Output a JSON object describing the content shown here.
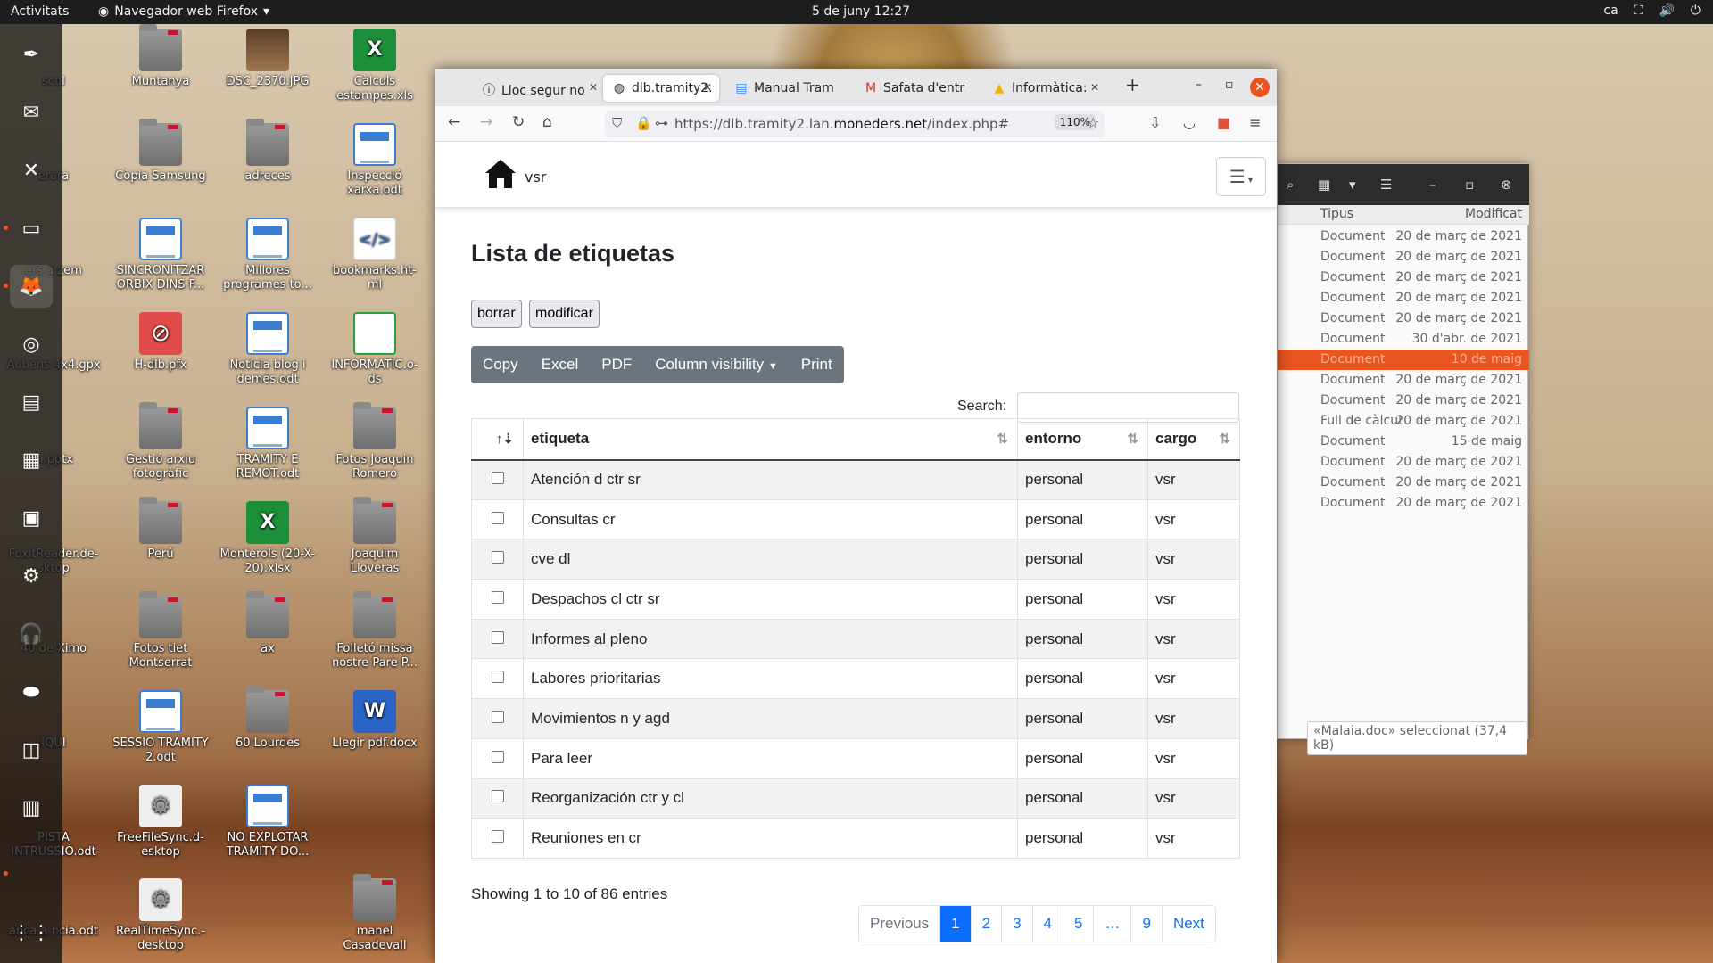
{
  "topbar": {
    "activities": "Activitats",
    "app": "Navegador web Firefox",
    "clock": "5 de juny  12:27",
    "lang": "ca"
  },
  "desktop": {
    "icons": [
      {
        "label": "Muntanya"
      },
      {
        "label": "DSC_2370.JPG"
      },
      {
        "label": "Càlculs estampes.xls"
      },
      {
        "label": "Còpia Samsung"
      },
      {
        "label": "adreces"
      },
      {
        "label": "Inspecció xarxa.odt"
      },
      {
        "label": "SINCRONITZAR ORBIX DINS F..."
      },
      {
        "label": "Millores programes to..."
      },
      {
        "label": "bookmarks.ht-ml"
      },
      {
        "label": "H-dlb.pfx"
      },
      {
        "label": "Notícia blog i demés.odt"
      },
      {
        "label": "INFORMATIC.o-ds"
      },
      {
        "label": "Gestió arxiu fotogràfic"
      },
      {
        "label": "TRAMITY E REMOT.odt"
      },
      {
        "label": "Fotos Joaquin Romero"
      },
      {
        "label": "Perú"
      },
      {
        "label": "Monterols (20-X-20).xlsx"
      },
      {
        "label": "Joaquim Lloveras"
      },
      {
        "label": "Fotos tiet Montserrat"
      },
      {
        "label": "ax"
      },
      {
        "label": "Folletó missa nostre Pare P..."
      },
      {
        "label": "SESSIO TRAMITY 2.odt"
      },
      {
        "label": "60 Lourdes"
      },
      {
        "label": "Llegir pdf.docx"
      },
      {
        "label": "FreeFileSync.d-esktop"
      },
      {
        "label": "NO EXPLOTAR TRAMITY DO..."
      },
      {
        "label": "RealTimeSync.-desktop"
      },
      {
        "label": "manel Casadevall"
      }
    ],
    "left_partial": [
      "scol",
      "erera",
      "ers a zem",
      "Aubens 4x4.gpx",
      "ci.pptx",
      "FoxitReader.de-sktop",
      "40 de Ximo",
      "IQUI",
      "PISTA INTRUSSIÓ.odt",
      "anca a ncia.odt"
    ]
  },
  "browser": {
    "tabs": [
      {
        "label": "Lloc segur no",
        "icon": "info-icon"
      },
      {
        "label": "dlb.tramity2.",
        "icon": "globe-icon"
      },
      {
        "label": "Manual Tram",
        "icon": "docs-icon"
      },
      {
        "label": "Safata d'entr",
        "icon": "gmail-icon"
      },
      {
        "label": "Informàtica:",
        "icon": "drive-icon"
      }
    ],
    "url_prefix": "https://dlb.tramity2.lan.",
    "url_domain": "moneders.net",
    "url_suffix": "/index.php#",
    "zoom": "110%"
  },
  "site": {
    "brand": "vsr"
  },
  "main": {
    "title": "Lista de etiquetas",
    "btn_delete": "borrar",
    "btn_modify": "modificar",
    "export_buttons": [
      "Copy",
      "Excel",
      "PDF",
      "Column visibility",
      "Print"
    ],
    "search_label": "Search:",
    "search_value": "",
    "columns": [
      "",
      "etiqueta",
      "entorno",
      "cargo"
    ],
    "rows": [
      {
        "etiqueta": "Atención d ctr sr",
        "entorno": "personal",
        "cargo": "vsr"
      },
      {
        "etiqueta": "Consultas cr",
        "entorno": "personal",
        "cargo": "vsr"
      },
      {
        "etiqueta": "cve dl",
        "entorno": "personal",
        "cargo": "vsr"
      },
      {
        "etiqueta": "Despachos cl ctr sr",
        "entorno": "personal",
        "cargo": "vsr"
      },
      {
        "etiqueta": "Informes al pleno",
        "entorno": "personal",
        "cargo": "vsr"
      },
      {
        "etiqueta": "Labores prioritarias",
        "entorno": "personal",
        "cargo": "vsr"
      },
      {
        "etiqueta": "Movimientos n y agd",
        "entorno": "personal",
        "cargo": "vsr"
      },
      {
        "etiqueta": "Para leer",
        "entorno": "personal",
        "cargo": "vsr"
      },
      {
        "etiqueta": "Reorganización ctr y cl",
        "entorno": "personal",
        "cargo": "vsr"
      },
      {
        "etiqueta": "Reuniones en cr",
        "entorno": "personal",
        "cargo": "vsr"
      }
    ],
    "info": "Showing 1 to 10 of 86 entries",
    "pagination": [
      "Previous",
      "1",
      "2",
      "3",
      "4",
      "5",
      "…",
      "9",
      "Next"
    ],
    "active_page": "1"
  },
  "files": {
    "col_type": "Tipus",
    "col_modified": "Modificat",
    "rows": [
      {
        "type": "Document",
        "modified": "20 de març de 2021"
      },
      {
        "type": "Document",
        "modified": "20 de març de 2021"
      },
      {
        "type": "Document",
        "modified": "20 de març de 2021"
      },
      {
        "type": "Document",
        "modified": "20 de març de 2021"
      },
      {
        "type": "Document",
        "modified": "20 de març de 2021"
      },
      {
        "type": "Document",
        "modified": "30 d'abr. de 2021"
      },
      {
        "type": "Document",
        "modified": "10 de maig"
      },
      {
        "type": "Document",
        "modified": "20 de març de 2021"
      },
      {
        "type": "Document",
        "modified": "20 de març de 2021"
      },
      {
        "type": "Full de càlcul",
        "modified": "20 de març de 2021"
      },
      {
        "type": "Document",
        "modified": "15 de maig"
      },
      {
        "type": "Document",
        "modified": "20 de març de 2021"
      },
      {
        "type": "Document",
        "modified": "20 de març de 2021"
      },
      {
        "type": "Document",
        "modified": "20 de març de 2021"
      }
    ],
    "selected_index": 6,
    "status": "«Malaia.doc» seleccionat  (37,4 kB)"
  },
  "colors": {
    "accent": "#e95420",
    "link": "#0d6efd",
    "dt_buttons": "#6c757d"
  }
}
